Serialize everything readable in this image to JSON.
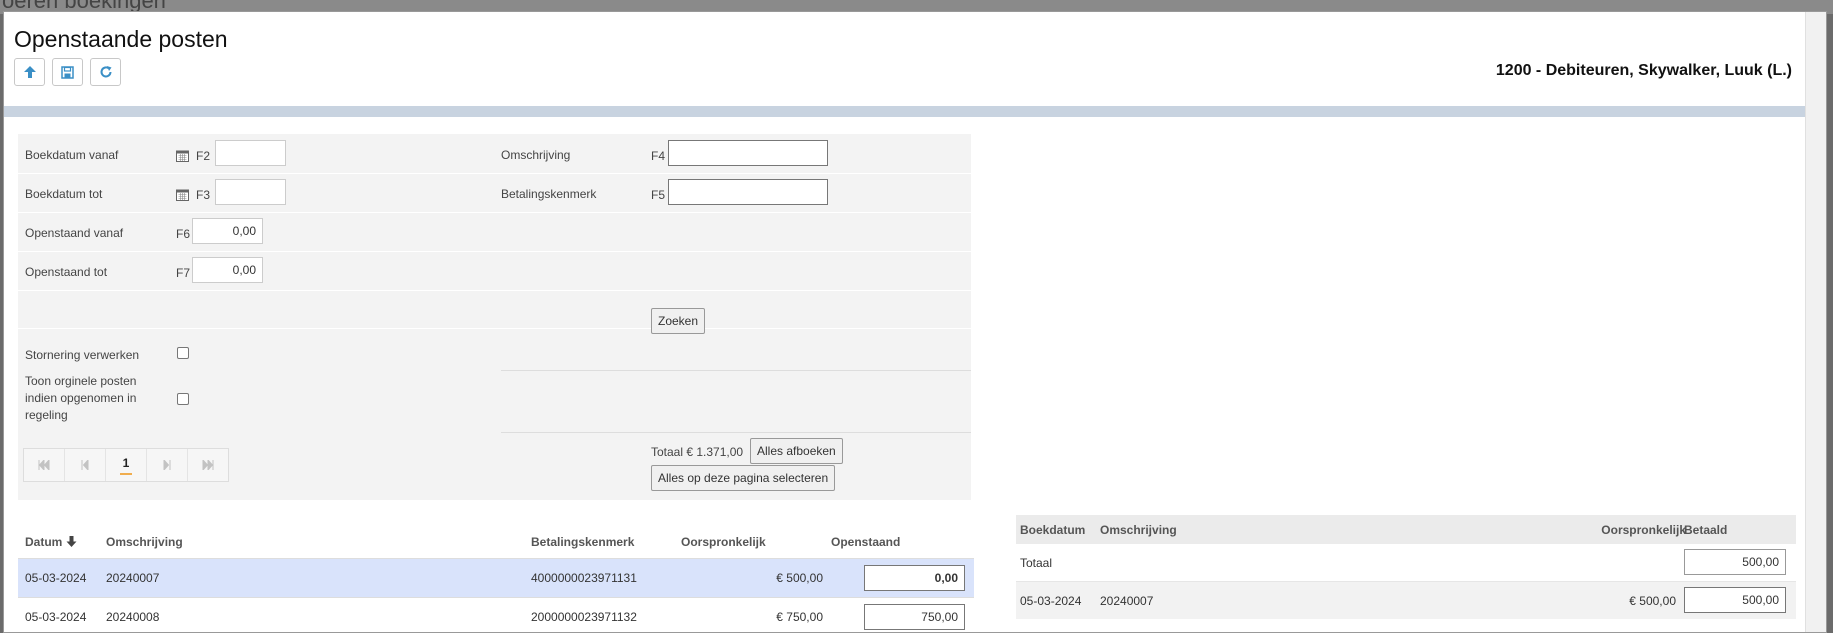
{
  "background_text": "oeren boekingen",
  "page": {
    "title": "Openstaande posten",
    "account": "1200 - Debiteuren, Skywalker, Luuk (L.)",
    "toolbar": [
      "arrow-up-icon",
      "save-icon",
      "refresh-icon"
    ]
  },
  "filters": {
    "boekdatum_vanaf": {
      "label": "Boekdatum vanaf",
      "key": "F2",
      "value": ""
    },
    "boekdatum_tot": {
      "label": "Boekdatum tot",
      "key": "F3",
      "value": ""
    },
    "openstaand_vanaf": {
      "label": "Openstaand vanaf",
      "key": "F6",
      "value": "0,00"
    },
    "openstaand_tot": {
      "label": "Openstaand tot",
      "key": "F7",
      "value": "0,00"
    },
    "omschrijving": {
      "label": "Omschrijving",
      "key": "F4",
      "value": ""
    },
    "betalingskenmerk": {
      "label": "Betalingskenmerk",
      "key": "F5",
      "value": ""
    },
    "zoeken": "Zoeken",
    "stornering": {
      "label": "Stornering verwerken",
      "checked": false
    },
    "toon": {
      "label_lines": [
        "Toon orginele posten",
        "indien opgenomen in",
        "regeling"
      ],
      "checked": false
    },
    "pager": {
      "current_page": "1"
    },
    "totaal": "Totaal € 1.371,00",
    "alles_afboeken": "Alles afboeken",
    "alles_selecteren": "Alles op deze pagina selecteren"
  },
  "left_table": {
    "headers": {
      "datum": "Datum",
      "omschrijving": "Omschrijving",
      "betalingskenmerk": "Betalingskenmerk",
      "oorspronkelijk": "Oorspronkelijk",
      "openstaand": "Openstaand"
    },
    "rows": [
      {
        "datum": "05-03-2024",
        "omschrijving": "20240007",
        "kenmerk": "4000000023971131",
        "oorspronkelijk": "€ 500,00",
        "openstaand": "0,00",
        "selected": true
      },
      {
        "datum": "05-03-2024",
        "omschrijving": "20240008",
        "kenmerk": "2000000023971132",
        "oorspronkelijk": "€ 750,00",
        "openstaand": "750,00",
        "selected": false
      }
    ]
  },
  "right_table": {
    "headers": {
      "boekdatum": "Boekdatum",
      "omschrijving": "Omschrijving",
      "oorspronkelijk": "Oorspronkelijk",
      "betaald": "Betaald"
    },
    "totaal": {
      "label": "Totaal",
      "betaald": "500,00"
    },
    "rows": [
      {
        "boekdatum": "05-03-2024",
        "omschrijving": "20240007",
        "oorspronkelijk": "€ 500,00",
        "betaald": "500,00"
      }
    ]
  },
  "colors": {
    "accent": "#3a8fc6",
    "selected_row": "#d9e3fb",
    "bar": "#c8d3e0"
  }
}
